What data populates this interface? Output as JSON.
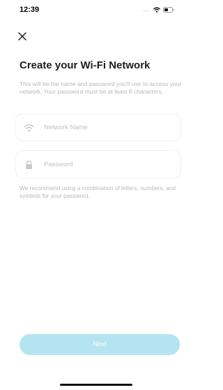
{
  "status_bar": {
    "time": "12:39",
    "signal": "....",
    "wifi_icon": "wifi-icon",
    "battery_icon": "battery-icon"
  },
  "header": {
    "close_icon": "close-icon",
    "title": "Create your Wi-Fi Network",
    "description": "This will be the name and password you'll use to access your network. Your password must be at least 8 characters."
  },
  "form": {
    "network_name": {
      "placeholder": "Network Name",
      "value": "",
      "icon": "wifi-icon"
    },
    "password": {
      "placeholder": "Password",
      "value": "",
      "icon": "lock-icon"
    },
    "hint": "We recommend using a combination of letters, numbers, and symbols for your password."
  },
  "footer": {
    "next_label": "Next"
  },
  "colors": {
    "accent_disabled": "#b4e4ef",
    "muted_text": "#b9b9bd",
    "title_text": "#1c1c1e"
  }
}
